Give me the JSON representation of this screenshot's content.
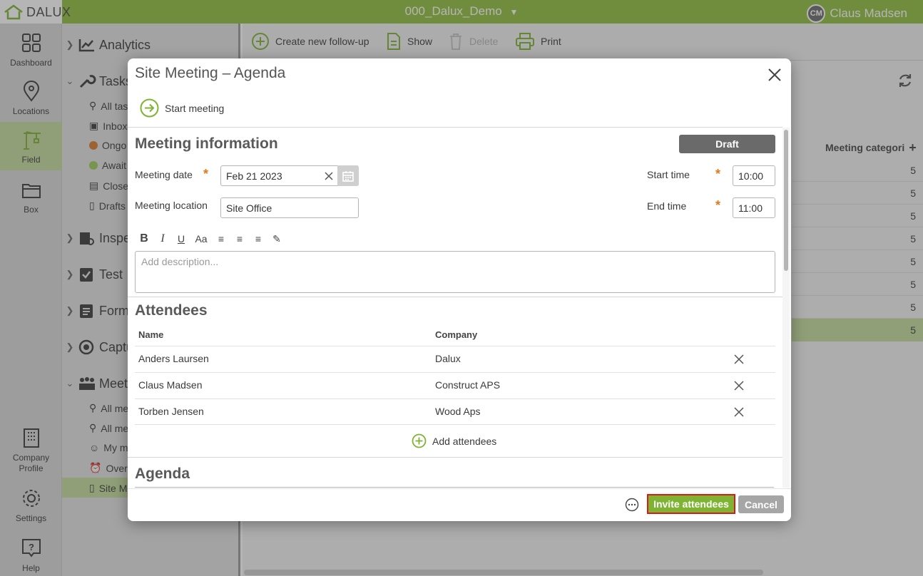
{
  "app": {
    "logo_text": "DALUX",
    "project": "000_Dalux_Demo",
    "user_initials": "CM",
    "user_name": "Claus Madsen"
  },
  "rail": [
    {
      "label": "Dashboard",
      "icon": "dashboard-icon"
    },
    {
      "label": "Locations",
      "icon": "location-pin-icon"
    },
    {
      "label": "Field",
      "icon": "crane-icon",
      "active": true
    },
    {
      "label": "Box",
      "icon": "folder-icon"
    },
    {
      "label": "Company Profile",
      "icon": "building-icon"
    },
    {
      "label": "Settings",
      "icon": "gear-icon"
    },
    {
      "label": "Help",
      "icon": "help-icon"
    }
  ],
  "tree": {
    "analytics": "Analytics",
    "tasks": "Tasks",
    "tasks_items": [
      "All tas",
      "Inbox",
      "Ongo",
      "Await",
      "Close",
      "Drafts"
    ],
    "inspection": "Inspe",
    "test": "Test",
    "forms": "Form",
    "capture": "Captu",
    "meetings": "Meet",
    "meetings_items": [
      "All me",
      "All me",
      "My m",
      "Overd",
      "Site M"
    ]
  },
  "toolbar": {
    "create": "Create new follow-up",
    "show": "Show",
    "delete": "Delete",
    "print": "Print"
  },
  "main": {
    "col_header": "Meeting categori",
    "values": [
      "5",
      "5",
      "5",
      "5",
      "5",
      "5",
      "5",
      "5"
    ]
  },
  "dialog": {
    "title": "Site Meeting – Agenda",
    "start_meeting": "Start meeting",
    "meeting_info_title": "Meeting information",
    "status": "Draft",
    "meeting_date_label": "Meeting date",
    "meeting_date_value": "Feb 21 2023",
    "meeting_location_label": "Meeting location",
    "meeting_location_value": "Site Office",
    "start_time_label": "Start time",
    "start_time_value": "10:00",
    "end_time_label": "End time",
    "end_time_value": "11:00",
    "description_placeholder": "Add description...",
    "attendees_title": "Attendees",
    "col_name": "Name",
    "col_company": "Company",
    "attendees": [
      {
        "name": "Anders Laursen",
        "company": "Dalux"
      },
      {
        "name": "Claus Madsen",
        "company": "Construct APS"
      },
      {
        "name": "Torben Jensen",
        "company": "Wood Aps"
      }
    ],
    "add_attendees": "Add attendees",
    "agenda_title": "Agenda",
    "invite_button": "Invite attendees",
    "cancel_button": "Cancel"
  },
  "colors": {
    "brand_green": "#8fbf3c",
    "button_green": "#7fb432",
    "required_orange": "#e07a1a",
    "highlight_red": "#d81a1a"
  }
}
